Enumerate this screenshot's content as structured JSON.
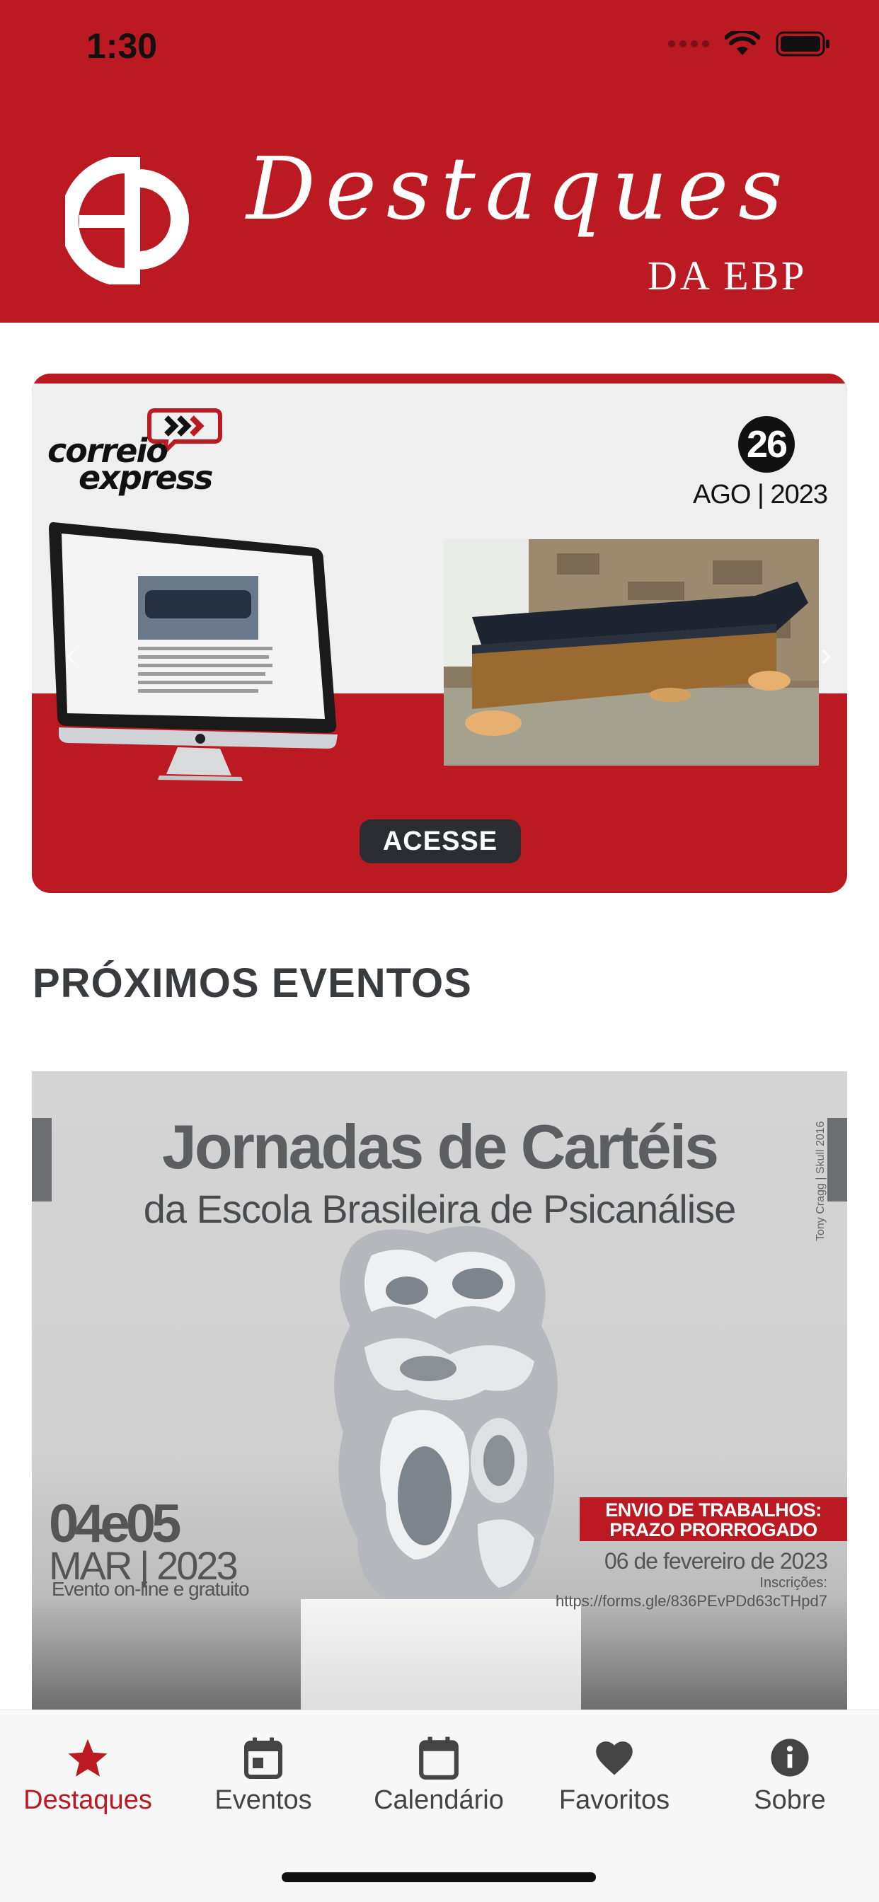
{
  "colors": {
    "brand": "#bc1a22",
    "dark_button": "#2b2d33",
    "tab_inactive": "#444444"
  },
  "status_bar": {
    "time": "1:30"
  },
  "header": {
    "logo_title": "Destaques",
    "logo_subtitle": "DA EBP"
  },
  "banner": {
    "brand_line1": "correio",
    "brand_line2": "express",
    "day": "26",
    "month_year": "AGO | 2023",
    "cta": "ACESSE"
  },
  "section": {
    "title": "PRÓXIMOS EVENTOS"
  },
  "event": {
    "title": "Jornadas de Cartéis",
    "subtitle": "da Escola Brasileira de Psicanálise",
    "credit": "Tony Cragg | Skull 2016",
    "dates": "04e05",
    "month_year": "MAR | 2023",
    "format": "Evento on-line e gratuito",
    "notice": "ENVIO DE TRABALHOS: PRAZO PRORROGADO",
    "deadline": "06 de fevereiro de 2023",
    "registration_label": "Inscrições:",
    "registration_url": "https://forms.gle/836PEvPDd63cTHpd7"
  },
  "tabs": [
    {
      "label": "Destaques",
      "icon": "star-icon",
      "active": true
    },
    {
      "label": "Eventos",
      "icon": "calendar-event-icon",
      "active": false
    },
    {
      "label": "Calendário",
      "icon": "calendar-icon",
      "active": false
    },
    {
      "label": "Favoritos",
      "icon": "heart-icon",
      "active": false
    },
    {
      "label": "Sobre",
      "icon": "info-icon",
      "active": false
    }
  ]
}
